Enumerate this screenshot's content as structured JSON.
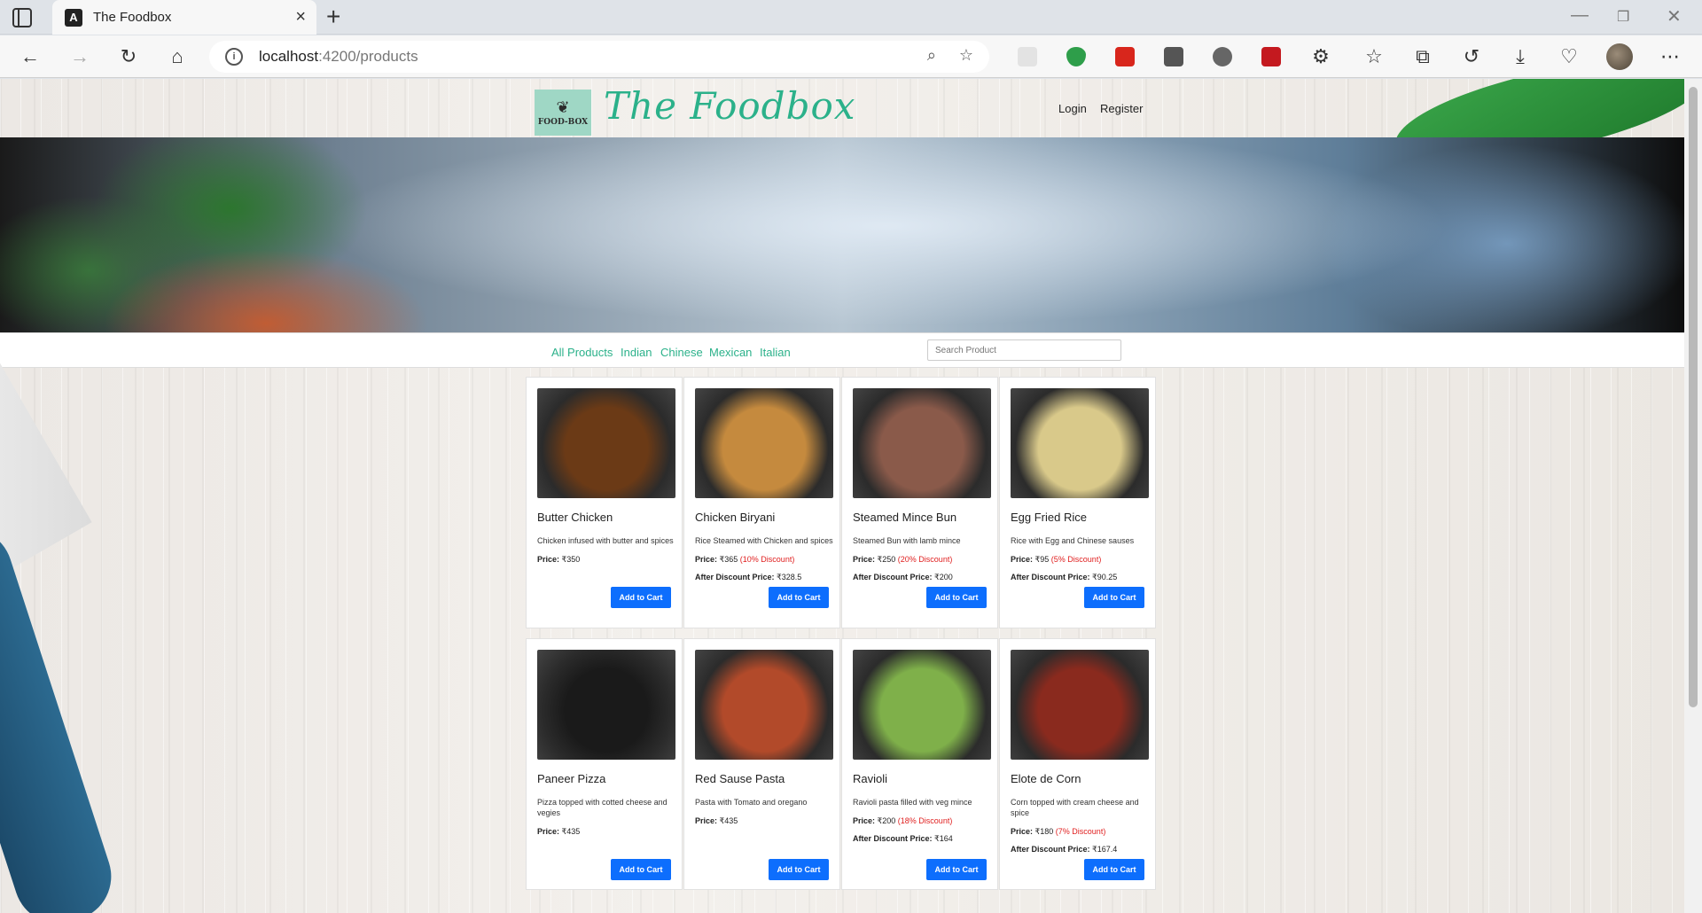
{
  "browser": {
    "tab_title": "The Foodbox",
    "tab_logo": "A",
    "address_host": "localhost",
    "address_path": ":4200/products"
  },
  "site": {
    "brand": "The Foodbox",
    "logo_text": "FOOD-BOX",
    "login": "Login",
    "register": "Register"
  },
  "filters": {
    "categories": [
      "All Products",
      "Indian",
      "Chinese",
      "Mexican",
      "Italian"
    ],
    "search_placeholder": "Search Product"
  },
  "products": [
    {
      "name": "Butter Chicken",
      "desc": "Chicken infused with butter and spices",
      "price_label": "Price:",
      "price": "₹350",
      "discount": "",
      "after_label": "",
      "after_price": "",
      "button": "Add to Cart",
      "img_color": "#6b3a16"
    },
    {
      "name": "Chicken Biryani",
      "desc": "Rice Steamed with Chicken and spices",
      "price_label": "Price:",
      "price": "₹365",
      "discount": "(10% Discount)",
      "after_label": "After Discount Price:",
      "after_price": "₹328.5",
      "button": "Add to Cart",
      "img_color": "#c58a3e"
    },
    {
      "name": "Steamed Mince Bun",
      "desc": "Steamed Bun with lamb mince",
      "price_label": "Price:",
      "price": "₹250",
      "discount": "(20% Discount)",
      "after_label": "After Discount Price:",
      "after_price": "₹200",
      "button": "Add to Cart",
      "img_color": "#8a5a4a"
    },
    {
      "name": "Egg Fried Rice",
      "desc": "Rice with Egg and Chinese sauses",
      "price_label": "Price:",
      "price": "₹95",
      "discount": "(5% Discount)",
      "after_label": "After Discount Price:",
      "after_price": "₹90.25",
      "button": "Add to Cart",
      "img_color": "#d9c98a"
    },
    {
      "name": "Paneer Pizza",
      "desc": "Pizza topped with cotted cheese and vegies",
      "price_label": "Price:",
      "price": "₹435",
      "discount": "",
      "after_label": "",
      "after_price": "",
      "button": "Add to Cart",
      "img_color": "#1a1a1a"
    },
    {
      "name": "Red Sause Pasta",
      "desc": "Pasta with Tomato and oregano",
      "price_label": "Price:",
      "price": "₹435",
      "discount": "",
      "after_label": "",
      "after_price": "",
      "button": "Add to Cart",
      "img_color": "#b24a2a"
    },
    {
      "name": "Ravioli",
      "desc": "Ravioli pasta filled with veg mince",
      "price_label": "Price:",
      "price": "₹200",
      "discount": "(18% Discount)",
      "after_label": "After Discount Price:",
      "after_price": "₹164",
      "button": "Add to Cart",
      "img_color": "#7fb04a"
    },
    {
      "name": "Elote de Corn",
      "desc": "Corn topped with cream cheese and spice",
      "price_label": "Price:",
      "price": "₹180",
      "discount": "(7% Discount)",
      "after_label": "After Discount Price:",
      "after_price": "₹167.4",
      "button": "Add to Cart",
      "img_color": "#8a2a1e"
    }
  ]
}
